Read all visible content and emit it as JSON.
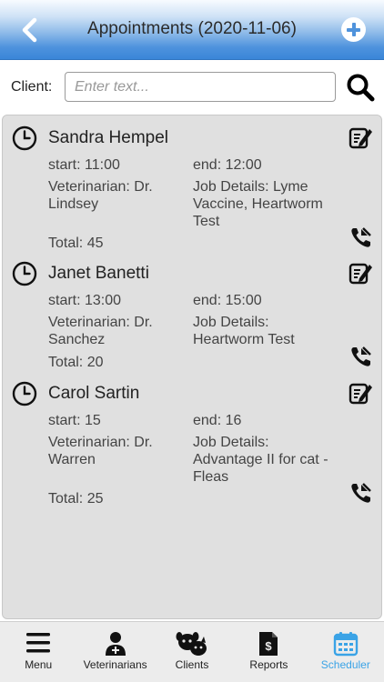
{
  "header": {
    "title": "Appointments (2020-11-06)"
  },
  "search": {
    "label": "Client:",
    "placeholder": "Enter text..."
  },
  "appointments": [
    {
      "name": "Sandra Hempel",
      "start": "start: 11:00",
      "end": "end: 12:00",
      "vet_line1": "Veterinarian: Dr.",
      "vet_line2": "Lindsey",
      "job_line1": "Job Details: Lyme",
      "job_line2": "Vaccine, Heartworm",
      "job_line3": "Test",
      "total": "Total: 45"
    },
    {
      "name": "Janet Banetti",
      "start": "start: 13:00",
      "end": "end: 15:00",
      "vet_line1": "Veterinarian: Dr.",
      "vet_line2": "Sanchez",
      "job_line1": "Job Details:",
      "job_line2": "Heartworm Test",
      "total": "Total: 20"
    },
    {
      "name": "Carol Sartin",
      "start": "start: 15",
      "end": "end: 16",
      "vet_line1": "Veterinarian: Dr.",
      "vet_line2": "Warren",
      "job_line1": "Job Details:",
      "job_line2": "Advantage II for cat -",
      "job_line3": "Fleas",
      "total": "Total: 25"
    }
  ],
  "tabs": [
    {
      "label": "Menu",
      "icon": "menu-icon"
    },
    {
      "label": "Veterinarians",
      "icon": "veterinarian-icon"
    },
    {
      "label": "Clients",
      "icon": "pets-icon"
    },
    {
      "label": "Reports",
      "icon": "report-icon"
    },
    {
      "label": "Scheduler",
      "icon": "calendar-icon",
      "active": true
    }
  ],
  "colors": {
    "accent": "#3aa3e6",
    "header": "#4e92dd",
    "list_bg": "#e0e0e0"
  }
}
